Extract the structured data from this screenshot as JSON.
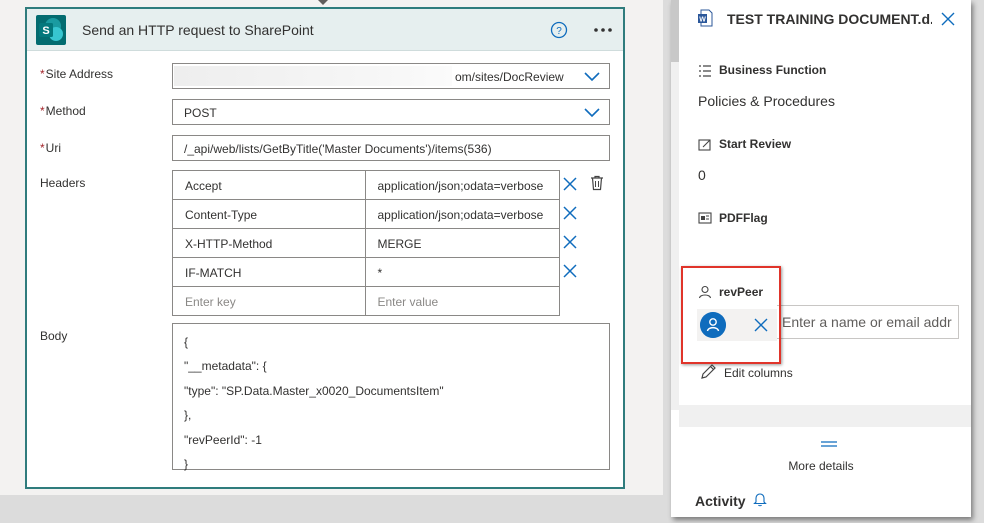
{
  "action_card": {
    "title": "Send an HTTP request to SharePoint",
    "site_address": {
      "label": "Site Address",
      "value": "om/sites/DocReview"
    },
    "method": {
      "label": "Method",
      "value": "POST"
    },
    "uri": {
      "label": "Uri",
      "value": "/_api/web/lists/GetByTitle('Master Documents')/items(536)"
    },
    "headers": {
      "label": "Headers",
      "rows": [
        {
          "key": "Accept",
          "value": "application/json;odata=verbose"
        },
        {
          "key": "Content-Type",
          "value": "application/json;odata=verbose"
        },
        {
          "key": "X-HTTP-Method",
          "value": "MERGE"
        },
        {
          "key": "IF-MATCH",
          "value": "*"
        }
      ],
      "key_placeholder": "Enter key",
      "value_placeholder": "Enter value"
    },
    "body": {
      "label": "Body",
      "lines": [
        "{",
        "\"__metadata\": {",
        "\"type\": \"SP.Data.Master_x0020_DocumentsItem\"",
        "},",
        "\"revPeerId\":  -1",
        "}"
      ]
    }
  },
  "details_pane": {
    "doc_title": "TEST TRAINING DOCUMENT.d...",
    "properties": [
      {
        "label": "Business Function",
        "value": "Policies & Procedures"
      },
      {
        "label": "Start Review",
        "value": "0"
      },
      {
        "label": "PDFFlag",
        "value": ""
      }
    ],
    "rev_peer": {
      "label": "revPeer",
      "placeholder": "Enter a name or email addr"
    },
    "edit_columns": "Edit columns",
    "more_details": "More details",
    "activity": "Activity"
  },
  "colors": {
    "card_border": "#2f7c7d",
    "card_header_bg": "#e6efef",
    "accent_blue": "#0f6cbd",
    "required_red": "#a4262c",
    "highlight_red": "#e0342a"
  },
  "icons": [
    "sharepoint-logo-icon",
    "help-icon",
    "more-icon",
    "chevron-down-icon",
    "close-icon",
    "delete-icon",
    "word-doc-icon",
    "list-icon",
    "edit-icon",
    "pdf-icon",
    "person-icon",
    "pencil-icon",
    "bell-icon"
  ]
}
